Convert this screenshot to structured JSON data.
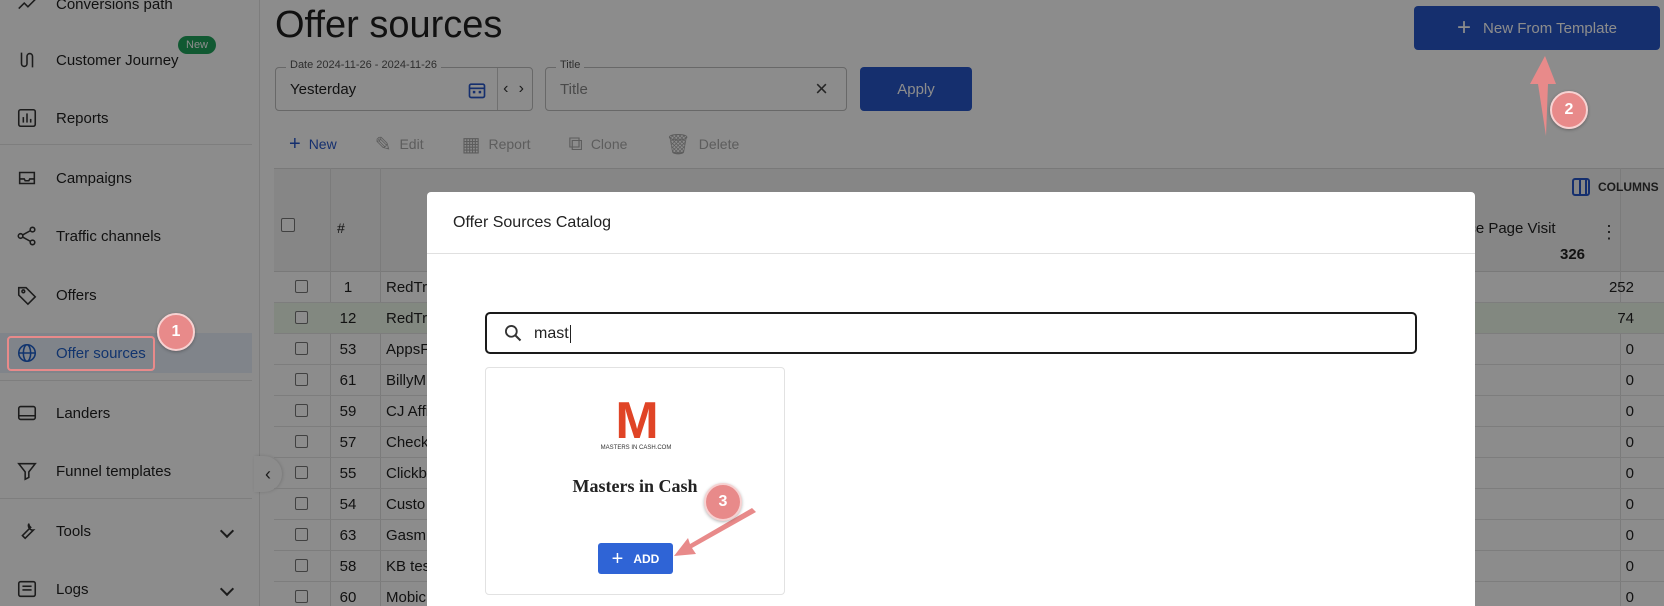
{
  "sidebar": {
    "items": [
      {
        "label": "Conversions path",
        "icon": "trend-line-icon"
      },
      {
        "label": "Customer Journey",
        "icon": "route-icon",
        "badge": "New"
      },
      {
        "label": "Reports",
        "icon": "bar-chart-icon"
      },
      {
        "label": "Campaigns",
        "icon": "inbox-icon"
      },
      {
        "label": "Traffic channels",
        "icon": "share-nodes-icon"
      },
      {
        "label": "Offers",
        "icon": "tag-icon"
      },
      {
        "label": "Offer sources",
        "icon": "globe-icon",
        "active": true
      },
      {
        "label": "Landers",
        "icon": "monitor-icon"
      },
      {
        "label": "Funnel templates",
        "icon": "funnel-icon"
      },
      {
        "label": "Tools",
        "icon": "wrench-icon",
        "expandable": true
      },
      {
        "label": "Logs",
        "icon": "list-icon",
        "expandable": true
      }
    ],
    "collapse_glyph": "‹"
  },
  "header": {
    "title": "Offer sources",
    "template_button": "New From Template"
  },
  "filters": {
    "date_label": "Date 2024-11-26 - 2024-11-26",
    "date_value": "Yesterday",
    "title_label": "Title",
    "title_placeholder": "Title",
    "apply": "Apply"
  },
  "toolbar": {
    "new": "New",
    "edit": "Edit",
    "report": "Report",
    "clone": "Clone",
    "delete": "Delete"
  },
  "grid": {
    "columns_label": "COLUMNS",
    "hash_header": "#",
    "visit_header": "rice Page Visit",
    "visit_total": "326",
    "rows": [
      {
        "id": "1",
        "name": "RedTr",
        "value": "252",
        "highlight": false
      },
      {
        "id": "12",
        "name": "RedTr",
        "value": "74",
        "highlight": true
      },
      {
        "id": "53",
        "name": "AppsF",
        "value": "0",
        "highlight": false
      },
      {
        "id": "61",
        "name": "BillyM",
        "value": "0",
        "highlight": false
      },
      {
        "id": "59",
        "name": "CJ Affi",
        "value": "0",
        "highlight": false
      },
      {
        "id": "57",
        "name": "Check",
        "value": "0",
        "highlight": false
      },
      {
        "id": "55",
        "name": "Clickb",
        "value": "0",
        "highlight": false
      },
      {
        "id": "54",
        "name": "Custo",
        "value": "0",
        "highlight": false
      },
      {
        "id": "63",
        "name": "Gasm",
        "value": "0",
        "highlight": false
      },
      {
        "id": "58",
        "name": "KB tes",
        "value": "0",
        "highlight": false
      },
      {
        "id": "60",
        "name": "Mobic",
        "value": "0",
        "highlight": false
      }
    ]
  },
  "dialog": {
    "title": "Offer Sources Catalog",
    "search_value": "mast",
    "card": {
      "logo_letter": "M",
      "logo_caption": "MASTERS IN CASH.COM",
      "name": "Masters in Cash",
      "add_label": "ADD"
    }
  },
  "annotations": {
    "step1": "1",
    "step2": "2",
    "step3": "3",
    "color": "#e88a8a"
  },
  "colors": {
    "primary": "#2757c9",
    "active_bg": "#eaf1fb",
    "new_badge": "#1fa35c",
    "logo_red": "#e04426"
  }
}
